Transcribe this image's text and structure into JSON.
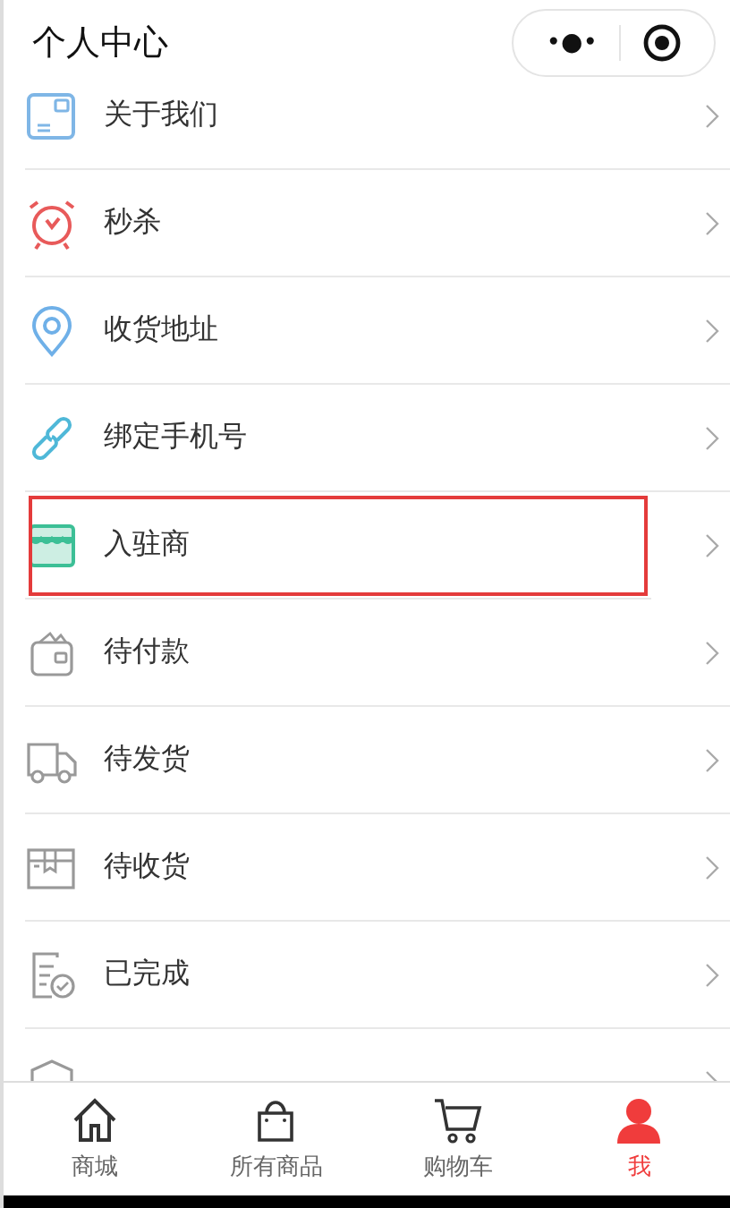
{
  "header": {
    "title": "个人中心",
    "more_glyph": "•●•"
  },
  "menu": [
    {
      "kind": "card",
      "label": "关于我们",
      "highlighted": false
    },
    {
      "kind": "alarm",
      "label": "秒杀",
      "highlighted": false
    },
    {
      "kind": "pin",
      "label": "收货地址",
      "highlighted": false
    },
    {
      "kind": "link",
      "label": "绑定手机号",
      "highlighted": false
    },
    {
      "kind": "shop",
      "label": "入驻商",
      "highlighted": true
    },
    {
      "kind": "wallet",
      "label": "待付款",
      "highlighted": false
    },
    {
      "kind": "truck",
      "label": "待发货",
      "highlighted": false
    },
    {
      "kind": "box",
      "label": "待收货",
      "highlighted": false
    },
    {
      "kind": "doc",
      "label": "已完成",
      "highlighted": false
    },
    {
      "kind": "shield",
      "highlighted": false
    }
  ],
  "tabbar": [
    {
      "kind": "home",
      "label": "商城",
      "selected": false
    },
    {
      "kind": "bag",
      "label": "所有商品",
      "selected": false
    },
    {
      "kind": "cart",
      "label": "购物车",
      "selected": false
    },
    {
      "kind": "person",
      "label": "我",
      "selected": true
    }
  ]
}
